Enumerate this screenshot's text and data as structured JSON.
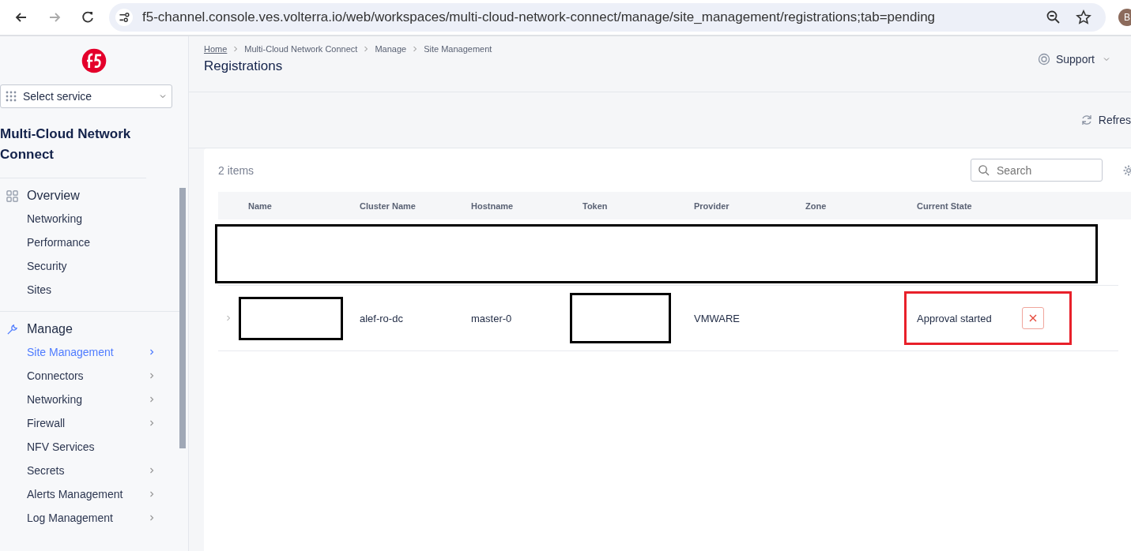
{
  "browser": {
    "url": "f5-channel.console.ves.volterra.io/web/workspaces/multi-cloud-network-connect/manage/site_management/registrations;tab=pending",
    "profile_initial": "B"
  },
  "sidebar": {
    "service_select": "Select service",
    "workspace_title": "Multi-Cloud Network Connect",
    "sections": [
      {
        "title": "Overview",
        "items": [
          {
            "label": "Networking",
            "selected": false,
            "expandable": false
          },
          {
            "label": "Performance",
            "selected": false,
            "expandable": false
          },
          {
            "label": "Security",
            "selected": false,
            "expandable": false
          },
          {
            "label": "Sites",
            "selected": false,
            "expandable": false
          }
        ]
      },
      {
        "title": "Manage",
        "items": [
          {
            "label": "Site Management",
            "selected": true,
            "expandable": true
          },
          {
            "label": "Connectors",
            "selected": false,
            "expandable": true
          },
          {
            "label": "Networking",
            "selected": false,
            "expandable": true
          },
          {
            "label": "Firewall",
            "selected": false,
            "expandable": true
          },
          {
            "label": "NFV Services",
            "selected": false,
            "expandable": false
          },
          {
            "label": "Secrets",
            "selected": false,
            "expandable": true
          },
          {
            "label": "Alerts Management",
            "selected": false,
            "expandable": true
          },
          {
            "label": "Log Management",
            "selected": false,
            "expandable": true
          }
        ]
      }
    ]
  },
  "header": {
    "breadcrumbs": [
      "Home",
      "Multi-Cloud Network Connect",
      "Manage",
      "Site Management"
    ],
    "title": "Registrations",
    "support": "Support"
  },
  "toolbar": {
    "refresh": "Refres"
  },
  "table": {
    "count": "2 items",
    "search_placeholder": "Search",
    "columns": [
      "Name",
      "Cluster Name",
      "Hostname",
      "Token",
      "Provider",
      "Zone",
      "Current State"
    ],
    "rows": [
      {
        "kind": "redacted"
      },
      {
        "kind": "registration",
        "name_redacted": true,
        "cluster_name": "alef-ro-dc",
        "hostname": "master-0",
        "token_redacted": true,
        "provider": "VMWARE",
        "current_state": "Approval started",
        "state_highlighted": true
      }
    ]
  }
}
